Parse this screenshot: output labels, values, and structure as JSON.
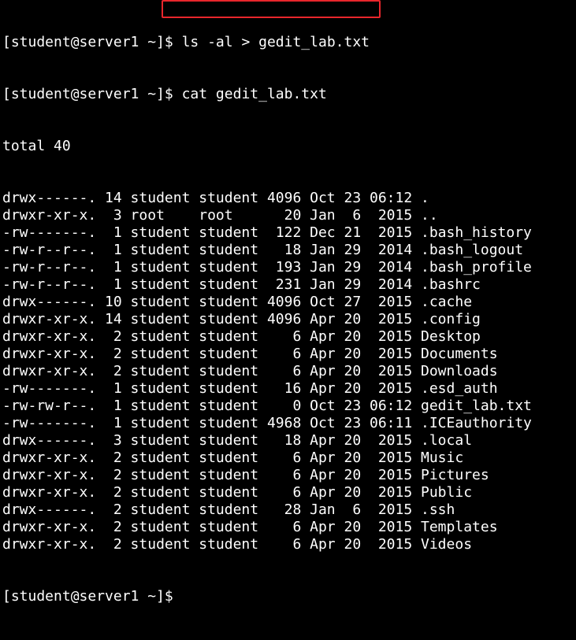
{
  "terminal": {
    "prompt": "[student@server1 ~]$",
    "command1": " ls -al > gedit_lab.txt",
    "command2": " cat gedit_lab.txt",
    "total": "total 40",
    "listing": [
      "drwx------. 14 student student 4096 Oct 23 06:12 .",
      "drwxr-xr-x.  3 root    root      20 Jan  6  2015 ..",
      "-rw-------.  1 student student  122 Dec 21  2015 .bash_history",
      "-rw-r--r--.  1 student student   18 Jan 29  2014 .bash_logout",
      "-rw-r--r--.  1 student student  193 Jan 29  2014 .bash_profile",
      "-rw-r--r--.  1 student student  231 Jan 29  2014 .bashrc",
      "drwx------. 10 student student 4096 Oct 27  2015 .cache",
      "drwxr-xr-x. 14 student student 4096 Apr 20  2015 .config",
      "drwxr-xr-x.  2 student student    6 Apr 20  2015 Desktop",
      "drwxr-xr-x.  2 student student    6 Apr 20  2015 Documents",
      "drwxr-xr-x.  2 student student    6 Apr 20  2015 Downloads",
      "-rw-------.  1 student student   16 Apr 20  2015 .esd_auth",
      "-rw-rw-r--.  1 student student    0 Oct 23 06:12 gedit_lab.txt",
      "-rw-------.  1 student student 4968 Oct 23 06:11 .ICEauthority",
      "drwx------.  3 student student   18 Apr 20  2015 .local",
      "drwxr-xr-x.  2 student student    6 Apr 20  2015 Music",
      "drwxr-xr-x.  2 student student    6 Apr 20  2015 Pictures",
      "drwxr-xr-x.  2 student student    6 Apr 20  2015 Public",
      "drwx------.  2 student student   28 Jan  6  2015 .ssh",
      "drwxr-xr-x.  2 student student    6 Apr 20  2015 Templates",
      "drwxr-xr-x.  2 student student    6 Apr 20  2015 Videos"
    ],
    "final_prompt": "[student@server1 ~]$"
  },
  "colors": {
    "background": "#000000",
    "text": "#ffffff",
    "highlight_border": "#e8262c"
  }
}
